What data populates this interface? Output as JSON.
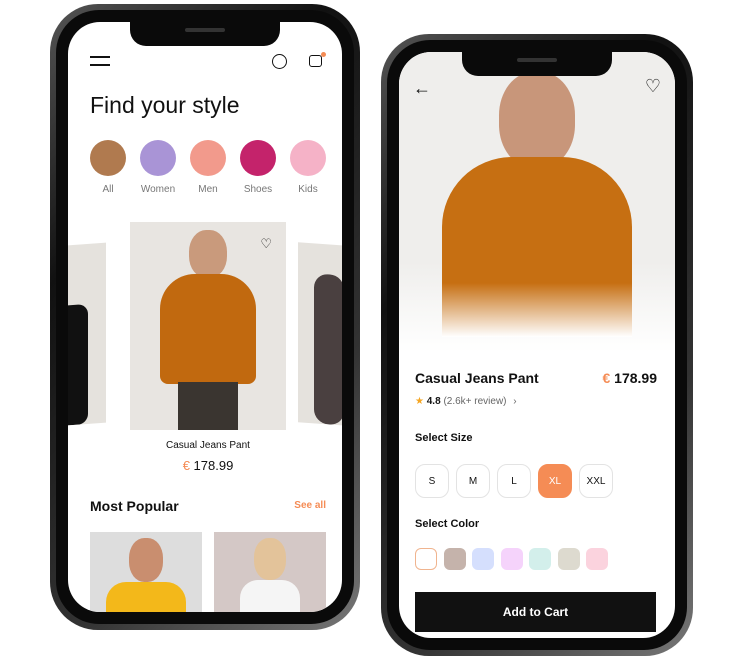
{
  "left": {
    "title": "Find your style",
    "categories": [
      {
        "label": "All",
        "color": "#b07a4f"
      },
      {
        "label": "Women",
        "color": "#a994d6"
      },
      {
        "label": "Men",
        "color": "#f29a8c"
      },
      {
        "label": "Shoes",
        "color": "#c4236b"
      },
      {
        "label": "Kids",
        "color": "#f5b2c7"
      }
    ],
    "product": {
      "name": "Casual Jeans Pant",
      "currency": "€",
      "price": "178.99"
    },
    "popular": {
      "title": "Most Popular",
      "see_all": "See all"
    }
  },
  "right": {
    "product": {
      "name": "Casual Jeans Pant",
      "currency": "€",
      "price": "178.99",
      "rating": "4.8",
      "reviews": "(2.6k+ review)"
    },
    "size_label": "Select Size",
    "sizes": [
      "S",
      "M",
      "L",
      "XL",
      "XXL"
    ],
    "selected_size": "XL",
    "color_label": "Select Color",
    "colors": [
      "#ffffff",
      "#c5b3ab",
      "#d5dffd",
      "#f5d3fb",
      "#d3efeb",
      "#dddacf",
      "#fbd3de"
    ],
    "selected_color": "#ffffff",
    "add_to_cart": "Add to Cart"
  },
  "accent": "#f58c55"
}
